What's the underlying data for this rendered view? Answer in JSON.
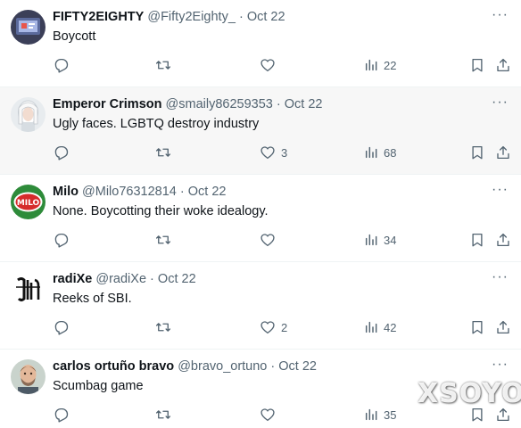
{
  "tweets": [
    {
      "name": "FIFTY2EIGHTY",
      "handle": "@Fifty2Eighty_",
      "sep": "·",
      "date": "Oct 22",
      "text": "Boycott",
      "replies": "",
      "retweets": "",
      "likes": "",
      "views": "22",
      "highlighted": false,
      "avatar_icon": "fifty2eighty-avatar"
    },
    {
      "name": "Emperor Crimson",
      "handle": "@smaily86259353",
      "sep": "·",
      "date": "Oct 22",
      "text": "Ugly faces. LGBTQ destroy industry",
      "replies": "",
      "retweets": "",
      "likes": "3",
      "views": "68",
      "highlighted": true,
      "avatar_icon": "white-hair-figure-avatar"
    },
    {
      "name": "Milo",
      "handle": "@Milo76312814",
      "sep": "·",
      "date": "Oct 22",
      "text": "None. Boycotting their woke idealogy.",
      "replies": "",
      "retweets": "",
      "likes": "",
      "views": "34",
      "highlighted": false,
      "avatar_icon": "milo-logo-avatar"
    },
    {
      "name": "radiXe",
      "handle": "@radiXe",
      "sep": "·",
      "date": "Oct 22",
      "text": "Reeks of SBI.",
      "replies": "",
      "retweets": "",
      "likes": "2",
      "views": "42",
      "highlighted": false,
      "avatar_icon": "gothic-monogram-avatar"
    },
    {
      "name": "carlos ortuño bravo",
      "handle": "@bravo_ortuno",
      "sep": "·",
      "date": "Oct 22",
      "text": "Scumbag game",
      "replies": "",
      "retweets": "",
      "likes": "",
      "views": "35",
      "highlighted": false,
      "avatar_icon": "man-face-avatar"
    }
  ],
  "more_glyph": "···",
  "watermark": "XSOYO",
  "colors": {
    "text": "#0f1419",
    "secondary": "#536471",
    "divider": "#eff3f4",
    "highlight_bg": "#f7f7f7"
  },
  "icons": [
    "reply-icon",
    "retweet-icon",
    "like-icon",
    "views-icon",
    "bookmark-icon",
    "share-icon",
    "more-icon"
  ]
}
